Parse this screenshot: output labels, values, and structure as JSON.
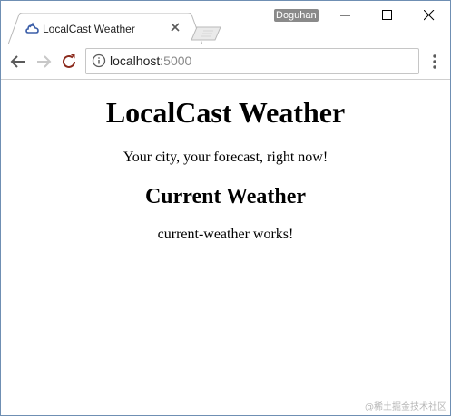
{
  "browser": {
    "tab_title": "LocalCast Weather",
    "profile_name": "Doguhan",
    "url_host": "localhost:",
    "url_port": "5000",
    "icons": {
      "favicon": "weather-cloud-icon",
      "tab_close": "close-icon",
      "back": "back-arrow-icon",
      "forward": "forward-arrow-icon",
      "reload": "reload-icon",
      "info": "info-icon",
      "menu": "kebab-menu-icon",
      "minimize": "minimize-icon",
      "maximize": "maximize-icon",
      "close_window": "close-window-icon"
    }
  },
  "page": {
    "title": "LocalCast Weather",
    "tagline": "Your city, your forecast, right now!",
    "section_title": "Current Weather",
    "component_text": "current-weather works!"
  },
  "watermark": "@稀土掘金技术社区",
  "colors": {
    "window_border": "#6f8fb3",
    "favicon": "#3b5ea8",
    "reload": "#8b2a1c"
  }
}
